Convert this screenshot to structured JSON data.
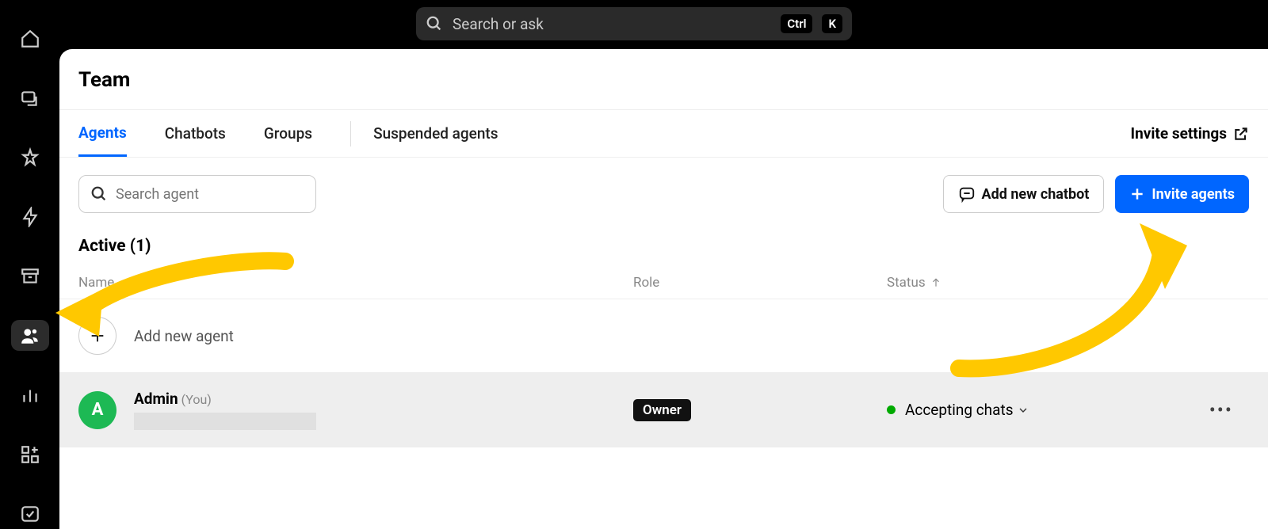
{
  "searchGlobal": {
    "placeholder": "Search or ask",
    "shortcut1": "Ctrl",
    "shortcut2": "K"
  },
  "pageTitle": "Team",
  "tabs": {
    "agents": "Agents",
    "chatbots": "Chatbots",
    "groups": "Groups",
    "suspended": "Suspended agents"
  },
  "inviteSettings": "Invite settings",
  "searchAgent": {
    "placeholder": "Search agent"
  },
  "buttons": {
    "addChatbot": "Add new chatbot",
    "inviteAgents": "Invite agents"
  },
  "sectionTitle": "Active (1)",
  "columns": {
    "name": "Name",
    "role": "Role",
    "status": "Status"
  },
  "addRow": {
    "label": "Add new agent"
  },
  "agent": {
    "avatarInitial": "A",
    "name": "Admin",
    "you": "(You)",
    "role": "Owner",
    "status": "Accepting chats"
  }
}
